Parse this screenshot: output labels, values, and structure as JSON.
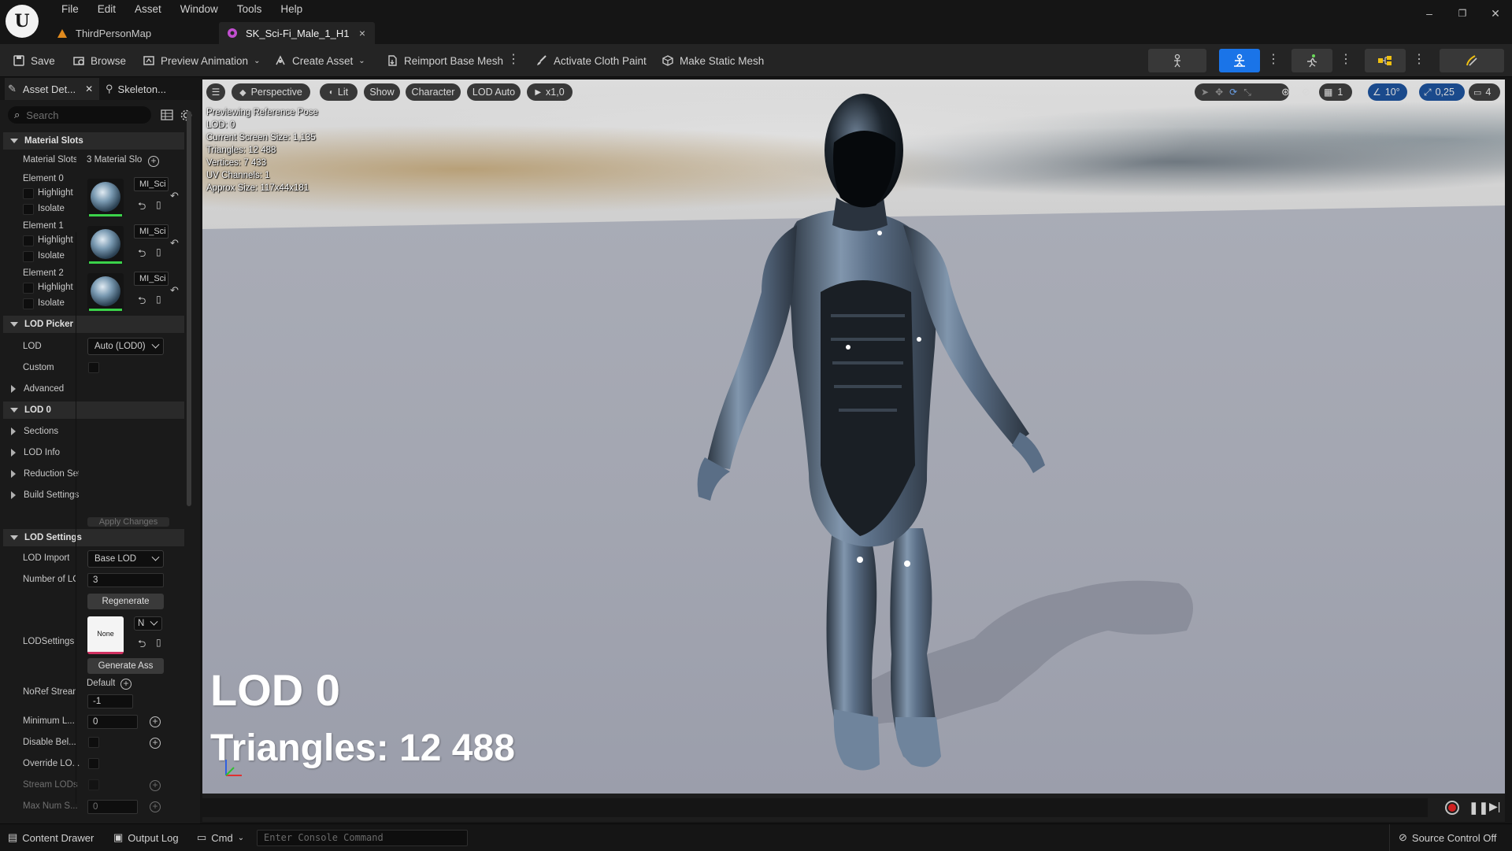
{
  "menu": [
    "File",
    "Edit",
    "Asset",
    "Window",
    "Tools",
    "Help"
  ],
  "tabs": [
    {
      "label": "ThirdPersonMap"
    },
    {
      "label": "SK_Sci-Fi_Male_1_H1",
      "close": "×"
    }
  ],
  "window_controls": {
    "minimize": "–",
    "restore": "❐",
    "close": "✕"
  },
  "toolbar": {
    "save": "Save",
    "browse": "Browse",
    "preview_animation": "Preview Animation",
    "create_asset": "Create Asset",
    "reimport": "Reimport Base Mesh",
    "cloth_paint": "Activate Cloth Paint",
    "static_mesh": "Make Static Mesh",
    "accent": "#1a74e8"
  },
  "panel": {
    "tab_details": "Asset Det...",
    "tab_skeleton": "Skeleton...",
    "search_placeholder": "Search",
    "material_slots_header": "Material Slots",
    "material_slots_label": "Material Slots",
    "material_slots_value": "3 Material Slo",
    "elements": [
      {
        "label": "Element 0",
        "highlight": "Highlight",
        "isolate": "Isolate",
        "mat": "MI_Sci"
      },
      {
        "label": "Element 1",
        "highlight": "Highlight",
        "isolate": "Isolate",
        "mat": "MI_Sci"
      },
      {
        "label": "Element 2",
        "highlight": "Highlight",
        "isolate": "Isolate",
        "mat": "MI_Sci"
      }
    ],
    "lod_picker_header": "LOD Picker",
    "lod_label": "LOD",
    "lod_value": "Auto (LOD0)",
    "custom_label": "Custom",
    "advanced": "Advanced",
    "lod0_header": "LOD 0",
    "sections": "Sections",
    "lod_info": "LOD Info",
    "reduction": "Reduction Settings",
    "build": "Build Settings",
    "apply_changes": "Apply Changes",
    "lod_settings_header": "LOD Settings",
    "lod_import_label": "LOD Import",
    "lod_import_value": "Base LOD",
    "num_lods_label": "Number of LODs",
    "num_lods_value": "3",
    "regenerate": "Regenerate",
    "lodsettings_label": "LODSettings",
    "none_label": "None",
    "n_value": "N",
    "generate_asset": "Generate Ass",
    "noref_label": "NoRef Streaming",
    "noref_default": "Default",
    "noref_value": "-1",
    "min_lod_label": "Minimum L...",
    "min_lod_value": "0",
    "disable_label": "Disable Bel...",
    "override_label": "Override LO...",
    "stream_label": "Stream LODs",
    "maxnum_label": "Max Num S...",
    "maxnum_value": "0"
  },
  "viewport": {
    "perspective": "Perspective",
    "lit": "Lit",
    "show": "Show",
    "character": "Character",
    "lod_auto": "LOD Auto",
    "speed": "x1,0",
    "grid_value": "1",
    "angle_value": "10°",
    "scale_value": "0,25",
    "camera_value": "4",
    "info_lines": [
      "Previewing Reference Pose",
      "LOD: 0",
      "Current Screen Size: 1,135",
      "Triangles: 12 488",
      "Vertices: 7 433",
      "UV Channels: 1",
      "Approx Size: 117x44x181"
    ],
    "lod_big": "LOD 0",
    "triangles_big": "Triangles: 12 488"
  },
  "statusbar": {
    "content_drawer": "Content Drawer",
    "output_log": "Output Log",
    "cmd": "Cmd",
    "console_placeholder": "Enter Console Command",
    "source_control": "Source Control Off"
  }
}
